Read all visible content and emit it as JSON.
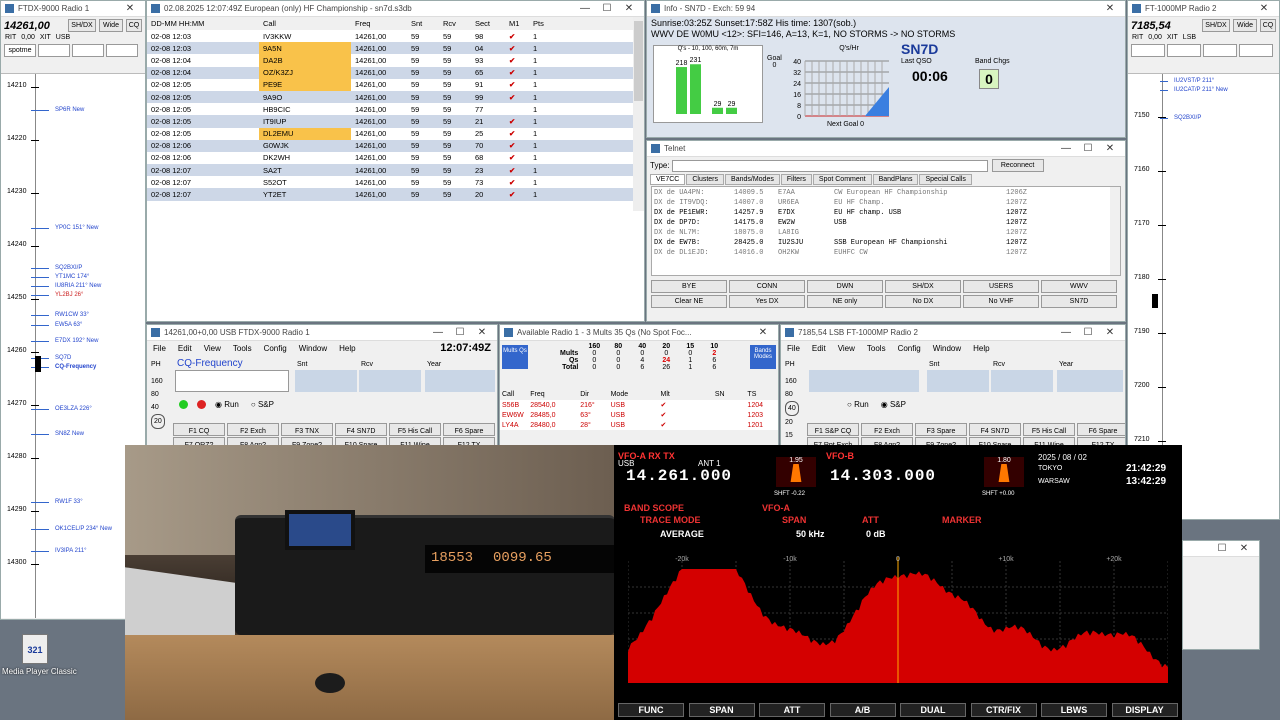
{
  "radio1_bandmap": {
    "title": "FTDX-9000 Radio 1",
    "freq": "14261,00",
    "buttons": [
      "SH/DX",
      "Wide",
      "CQ"
    ],
    "rit": "RIT",
    "rit_val": "0,00",
    "xit": "XIT",
    "mode": "USB",
    "spotme": "spotme",
    "ticks": [
      "14210",
      "14220",
      "14230",
      "14240",
      "14250",
      "14260",
      "14270",
      "14280",
      "14290",
      "14300"
    ],
    "spots": [
      {
        "label": "SP6R  New",
        "color": "#2244cc"
      },
      {
        "label": "YP0C 151° New",
        "color": "#2244cc"
      },
      {
        "label": "SQ2BXI/P",
        "color": "#2244cc"
      },
      {
        "label": "YT1MC 174°",
        "color": "#2244cc"
      },
      {
        "label": "IU8RIA 211° New",
        "color": "#2244cc"
      },
      {
        "label": "YL2BJ 26°",
        "color": "#cc2222"
      },
      {
        "label": "RW1CW 33°",
        "color": "#2244cc"
      },
      {
        "label": "EW5A 63°",
        "color": "#2244cc"
      },
      {
        "label": "E7DX 192° New",
        "color": "#2244cc"
      },
      {
        "label": "SQ7D",
        "color": "#2244cc"
      },
      {
        "label": "CQ-Frequency",
        "color": "#2244cc"
      },
      {
        "label": "OE3LZA 226°",
        "color": "#2244cc"
      },
      {
        "label": "SN8Z  New",
        "color": "#2244cc"
      },
      {
        "label": "RW1F 33°",
        "color": "#2244cc"
      },
      {
        "label": "OK1CEL/P 234° New",
        "color": "#2244cc"
      },
      {
        "label": "IV3IPA 211°",
        "color": "#2244cc"
      }
    ]
  },
  "log": {
    "title": "02.08.2025 12:07:49Z  European (only) HF Championship - sn7d.s3db",
    "headers": [
      "DD-MM HH:MM",
      "Call",
      "Freq",
      "Snt",
      "Rcv",
      "Sect",
      "M1",
      "Pts"
    ],
    "rows": [
      [
        "02-08 12:03",
        "IV3KKW",
        "14261,00",
        "59",
        "59",
        "98",
        "✔",
        "1"
      ],
      [
        "02-08 12:03",
        "9A5N",
        "14261,00",
        "59",
        "59",
        "04",
        "✔",
        "1"
      ],
      [
        "02-08 12:04",
        "DA2B",
        "14261,00",
        "59",
        "59",
        "93",
        "✔",
        "1"
      ],
      [
        "02-08 12:04",
        "OZ/K3ZJ",
        "14261,00",
        "59",
        "59",
        "65",
        "✔",
        "1"
      ],
      [
        "02-08 12:05",
        "PE9E",
        "14261,00",
        "59",
        "59",
        "91",
        "✔",
        "1"
      ],
      [
        "02-08 12:05",
        "9A9O",
        "14261,00",
        "59",
        "59",
        "99",
        "✔",
        "1"
      ],
      [
        "02-08 12:05",
        "HB9CIC",
        "14261,00",
        "59",
        "59",
        "77",
        "",
        "1"
      ],
      [
        "02-08 12:05",
        "IT9IUP",
        "14261,00",
        "59",
        "59",
        "21",
        "✔",
        "1"
      ],
      [
        "02-08 12:05",
        "DL2EMU",
        "14261,00",
        "59",
        "59",
        "25",
        "✔",
        "1"
      ],
      [
        "02-08 12:06",
        "G0WJK",
        "14261,00",
        "59",
        "59",
        "70",
        "✔",
        "1"
      ],
      [
        "02-08 12:06",
        "DK2WH",
        "14261,00",
        "59",
        "59",
        "68",
        "✔",
        "1"
      ],
      [
        "02-08 12:07",
        "SA2T",
        "14261,00",
        "59",
        "59",
        "23",
        "✔",
        "1"
      ],
      [
        "02-08 12:07",
        "S52OT",
        "14261,00",
        "59",
        "59",
        "73",
        "✔",
        "1"
      ],
      [
        "02-08 12:07",
        "YT2ET",
        "14261,00",
        "59",
        "59",
        "20",
        "✔",
        "1"
      ]
    ],
    "dupes": [
      1,
      2,
      3,
      4,
      8
    ]
  },
  "info": {
    "title": "Info - SN7D - Exch: 59 94",
    "line1": "Sunrise:03:25Z Sunset:17:58Z His time: 1307(sob.)",
    "line2": "WWV DE W0MU <12>:   SFI=146, A=13, K=1, NO STORMS -> NO STORMS",
    "qs_label": "Q's - 10, 100, 60m, 7m",
    "goal_label": "Goal",
    "goal_val": "0",
    "qhr_label": "Q's/Hr",
    "call": "SN7D",
    "last_qso_label": "Last QSO",
    "last_qso": "00:06",
    "band_chgs_label": "Band Chgs",
    "band_chgs": "0",
    "next_goal": "Next Goal 0",
    "bars": [
      {
        "label": "218",
        "value": 218
      },
      {
        "label": "231",
        "value": 231
      },
      {
        "label": "29",
        "value": 29
      },
      {
        "label": "29",
        "value": 29
      }
    ],
    "yticks": [
      "40",
      "32",
      "24",
      "16",
      "8",
      "0"
    ]
  },
  "telnet": {
    "title": "Telnet",
    "type_label": "Type:",
    "reconnect": "Reconnect",
    "tabs": [
      "VE7CC",
      "Clusters",
      "Bands/Modes",
      "Filters",
      "Spot Comment",
      "BandPlans",
      "Special Calls"
    ],
    "lines": [
      [
        "DX de UA4PN:",
        "14009.5",
        "E7AA",
        "CW European HF Championship",
        "1206Z"
      ],
      [
        "DX de IT9VDQ:",
        "14007.0",
        "UR6EA",
        "EU HF Champ.",
        "1207Z"
      ],
      [
        "DX de PE1EWR:",
        "14257.9",
        "E7DX",
        "EU HF champ. USB",
        "1207Z"
      ],
      [
        "DX de DP7D:",
        "14175.0",
        "EW2W",
        "USB",
        "1207Z"
      ],
      [
        "DX de NL7M:",
        "18075.0",
        "LA8IG",
        "",
        "1207Z"
      ],
      [
        "DX de EW7B:",
        "28425.0",
        "IU2SJU",
        "SSB European HF Championshi",
        "1207Z"
      ],
      [
        "DX de DL1EJD:",
        "14016.0",
        "OH2KW",
        "EUHFC CW",
        "1207Z"
      ]
    ],
    "bold_rows": [
      2,
      3,
      5
    ],
    "buttons": [
      "BYE",
      "CONN",
      "DWN",
      "SH/DX",
      "USERS",
      "WWV",
      "Clear NE",
      "Yes DX",
      "NE only",
      "No DX",
      "No VHF",
      "SN7D"
    ]
  },
  "entry1": {
    "title": "14261,00+0,00 USB FTDX-9000 Radio 1",
    "menus": [
      "File",
      "Edit",
      "View",
      "Tools",
      "Config",
      "Window",
      "Help"
    ],
    "time": "12:07:49Z",
    "ph": "PH",
    "cq": "CQ-Frequency",
    "snt": "Snt",
    "rcv": "Rcv",
    "year": "Year",
    "power": [
      "160",
      "80",
      "40",
      "20"
    ],
    "run": "Run",
    "sp": "S&P",
    "fkeys": [
      "F1 CQ",
      "F2 Exch",
      "F3 TNX",
      "F4 SN7D",
      "F5 His Call",
      "F6 Spare"
    ],
    "fkeys2": [
      "F7 QRZ?",
      "F8 Agn?",
      "F9 Zone?",
      "F10 Spare",
      "F11 Wipe",
      "F12 TX"
    ]
  },
  "mults": {
    "title": "Available Radio 1 - 3 Mults 35 Qs  (No Spot Foc...",
    "mults_btn": "Mults Qs",
    "bands_btn": "Bands Modes",
    "bands": [
      "160",
      "80",
      "40",
      "20",
      "15",
      "10"
    ],
    "rows": [
      {
        "label": "Mults",
        "vals": [
          "0",
          "0",
          "0",
          "0",
          "0",
          "2"
        ]
      },
      {
        "label": "Qs",
        "vals": [
          "0",
          "0",
          "4",
          "24",
          "1",
          "6"
        ]
      },
      {
        "label": "Total",
        "vals": [
          "0",
          "0",
          "6",
          "26",
          "1",
          "6"
        ]
      }
    ],
    "headers": [
      "Call",
      "Freq",
      "Dir",
      "Mode",
      "Mlt",
      "SN",
      "TS"
    ],
    "spots": [
      [
        "S56B",
        "28540,0",
        "216°",
        "USB",
        "✔",
        "",
        "1204"
      ],
      [
        "EW6W",
        "28485,0",
        "63°",
        "USB",
        "✔",
        "",
        "1203"
      ],
      [
        "LY4A",
        "28480,0",
        "28°",
        "USB",
        "✔",
        "",
        "1201"
      ]
    ]
  },
  "entry2": {
    "title": "7185,54 LSB FT-1000MP Radio 2",
    "menus": [
      "File",
      "Edit",
      "View",
      "Tools",
      "Config",
      "Window",
      "Help"
    ],
    "ph": "PH",
    "snt": "Snt",
    "rcv": "Rcv",
    "year": "Year",
    "power": [
      "160",
      "80",
      "40",
      "20",
      "15"
    ],
    "run": "Run",
    "sp": "S&P",
    "fkeys": [
      "F1 S&P CQ",
      "F2 Exch",
      "F3 Spare",
      "F4 SN7D",
      "F5 His Call",
      "F6 Spare"
    ],
    "fkeys2": [
      "F7 Rpt Exch",
      "F8 Agn?",
      "F9 Zone?",
      "F10 Spare",
      "F11 Wipe",
      "F12 TX"
    ]
  },
  "radio2_bandmap": {
    "title": "FT-1000MP Radio 2",
    "freq": "7185,54",
    "buttons": [
      "SH/DX",
      "Wide",
      "CQ"
    ],
    "rit": "RIT",
    "rit_val": "0,00",
    "xit": "XIT",
    "mode": "LSB",
    "ticks": [
      "7150",
      "7160",
      "7170",
      "7180",
      "7190",
      "7200",
      "7210"
    ],
    "spots": [
      {
        "label": "IU2VST/P 211°",
        "color": "#2244cc"
      },
      {
        "label": "IU2CAT/P 211° New",
        "color": "#2244cc"
      },
      {
        "label": "SQ2BXI/P",
        "color": "#2244cc"
      }
    ]
  },
  "desktop": {
    "mpc_label": "Media Player Classic"
  },
  "photo": {
    "display_digits": "18553",
    "display_digits2": "0099.65"
  },
  "ftdx": {
    "vfoa": "VFO-A",
    "rx": "RX",
    "tx": "TX",
    "usb": "USB",
    "ant": "ANT 1",
    "freq_a": "14.261.000",
    "vfob": "VFO-B",
    "freq_b": "14.303.000",
    "date": "2025 / 08 / 02",
    "tokyo": "TOKYO",
    "tokyo_time": "21:42:29",
    "warsaw": "WARSAW",
    "warsaw_time": "13:42:29",
    "band_scope": "BAND SCOPE",
    "vfo_a_label": "VFO-A",
    "trace_mode": "TRACE MODE",
    "span": "SPAN",
    "att": "ATT",
    "marker": "MARKER",
    "average": "AVERAGE",
    "span_val": "50 kHz",
    "att_val": "0 dB",
    "scale": [
      "-20k",
      "-10k",
      "0",
      "+10k",
      "+20k"
    ],
    "softkeys": [
      "FUNC",
      "SPAN",
      "ATT",
      "A/B",
      "DUAL",
      "CTR/FIX",
      "LBWS",
      "DISPLAY"
    ],
    "shift_a": "SHFT -0.22",
    "shift_b": "SHFT +0.00",
    "width_a": "1.95",
    "width_b": "1.80"
  }
}
